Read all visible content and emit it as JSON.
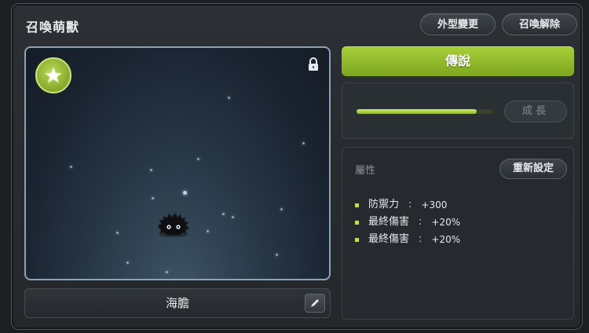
{
  "window": {
    "title": "召喚萌獸",
    "buttons": {
      "change_appearance": "外型變更",
      "release": "召喚解除"
    }
  },
  "preview": {
    "rank_icon": "star-icon",
    "lock_icon": "lock-icon",
    "pet_name": "海膽",
    "edit_icon": "pencil-icon"
  },
  "rank": {
    "label": "傳說",
    "color": "#9cc432"
  },
  "growth": {
    "button_label": "成長",
    "progress": 0.88,
    "bar_color": "#b5d84e"
  },
  "attributes": {
    "title": "屬性",
    "reset_label": "重新設定",
    "stats": [
      {
        "label": "防禦力",
        "sep": ":",
        "value": "+300"
      },
      {
        "label": "最終傷害",
        "sep": ":",
        "value": "+20%"
      },
      {
        "label": "最終傷害",
        "sep": ":",
        "value": "+20%"
      }
    ]
  }
}
